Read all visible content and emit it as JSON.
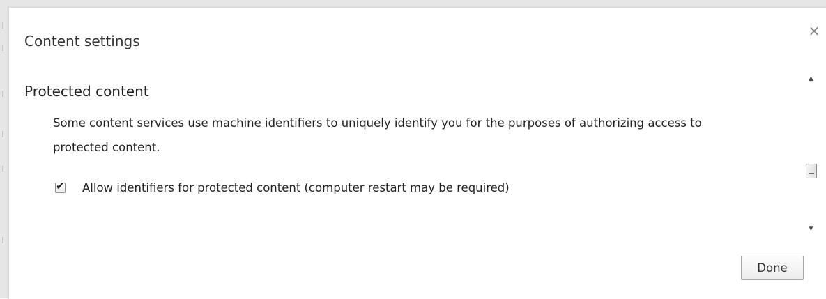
{
  "dialog": {
    "title": "Content settings",
    "close_icon": "close-icon",
    "close_glyph": "×"
  },
  "section": {
    "heading": "Protected content",
    "description": "Some content services use machine identifiers to uniquely identify you for the purposes of authorizing access to protected content.",
    "checkbox": {
      "label": "Allow identifiers for protected content (computer restart may be required)",
      "checked": true,
      "check_glyph": "✔"
    }
  },
  "scrollbar": {
    "up_glyph": "▲",
    "down_glyph": "▼"
  },
  "footer": {
    "done_label": "Done"
  },
  "colors": {
    "text": "#222222",
    "close": "#7a7a7a",
    "button_border": "#a9a9a9"
  }
}
